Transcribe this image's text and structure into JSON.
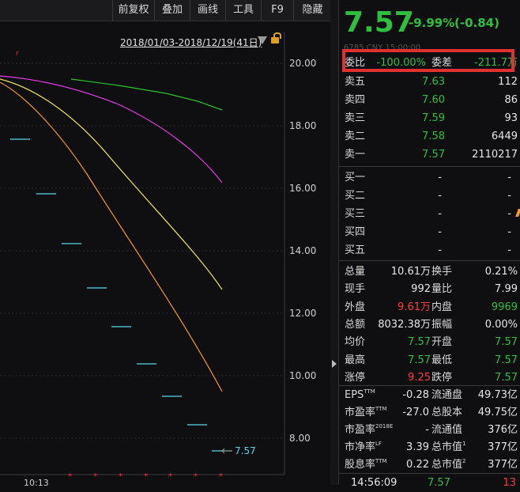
{
  "toolbar": {
    "items": [
      "前复权",
      "叠加",
      "画线",
      "工具",
      "F9",
      "隐藏"
    ]
  },
  "chart": {
    "date_range": "2018/01/03-2018/12/19(41日)",
    "y_ticks": [
      "20.00",
      "18.00",
      "16.00",
      "14.00",
      "12.00",
      "10.00",
      "8.00"
    ],
    "last_price_label": "7.57",
    "bottom_time": "10:13",
    "colors": {
      "magenta": "#e23be2",
      "green": "#27c627",
      "yellow": "#f0e650",
      "orange": "#f59a23",
      "cyan": "#54d6e8",
      "red": "#ff2a2a"
    }
  },
  "quote": {
    "price": "7.57",
    "change_pct": "-9.99%",
    "change": "(-0.84)",
    "subline": "6785  CNY  15:00:00"
  },
  "weibi": {
    "label": "委比",
    "value": "-100.00%",
    "label2": "委差",
    "value2": "-211.7万"
  },
  "sell": [
    {
      "label": "卖五",
      "price": "7.63",
      "vol": "112"
    },
    {
      "label": "卖四",
      "price": "7.60",
      "vol": "86"
    },
    {
      "label": "卖三",
      "price": "7.59",
      "vol": "93"
    },
    {
      "label": "卖二",
      "price": "7.58",
      "vol": "6449"
    },
    {
      "label": "卖一",
      "price": "7.57",
      "vol": "2110217"
    }
  ],
  "buy": [
    {
      "label": "买一",
      "price": "-",
      "vol": "-"
    },
    {
      "label": "买二",
      "price": "-",
      "vol": "-"
    },
    {
      "label": "买三",
      "price": "-",
      "vol": "-"
    },
    {
      "label": "买四",
      "price": "-",
      "vol": "-"
    },
    {
      "label": "买五",
      "price": "-",
      "vol": "-"
    }
  ],
  "stats": [
    {
      "l1": "总量",
      "v1": "10.61万",
      "c1": "white",
      "l2": "换手",
      "v2": "0.21%",
      "c2": "white"
    },
    {
      "l1": "现手",
      "v1": "992",
      "c1": "white",
      "l2": "量比",
      "v2": "7.99",
      "c2": "white"
    },
    {
      "l1": "外盘",
      "v1": "9.61万",
      "c1": "red",
      "l2": "内盘",
      "v2": "9969",
      "c2": "green"
    },
    {
      "l1": "总额",
      "v1": "8032.38万",
      "c1": "white",
      "l2": "振幅",
      "v2": "0.00%",
      "c2": "white"
    },
    {
      "l1": "均价",
      "v1": "7.57",
      "c1": "green",
      "l2": "开盘",
      "v2": "7.57",
      "c2": "green"
    },
    {
      "l1": "最高",
      "v1": "7.57",
      "c1": "green",
      "l2": "最低",
      "v2": "7.57",
      "c2": "green"
    },
    {
      "l1": "涨停",
      "v1": "9.25",
      "c1": "red",
      "l2": "跌停",
      "v2": "7.57",
      "c2": "green"
    }
  ],
  "fund": [
    {
      "l1": "EPS",
      "s1": "TTM",
      "v1": "-0.28",
      "l2": "流通盘",
      "s2": "",
      "v2": "49.73亿"
    },
    {
      "l1": "市盈率",
      "s1": "TTM",
      "v1": "-27.0",
      "l2": "总股本",
      "s2": "",
      "v2": "49.75亿"
    },
    {
      "l1": "市盈率",
      "s1": "2018E",
      "v1": "-",
      "l2": "流通值",
      "s2": "",
      "v2": "376亿"
    },
    {
      "l1": "市净率",
      "s1": "LF",
      "v1": "3.39",
      "l2": "总市值",
      "s2": "1",
      "v2": "377亿"
    },
    {
      "l1": "股息率",
      "s1": "TTM",
      "v1": "0.22",
      "l2": "总市值",
      "s2": "2",
      "v2": "377亿"
    }
  ],
  "tick": {
    "time": "14:56:09",
    "price": "7.57",
    "vol": "13"
  }
}
